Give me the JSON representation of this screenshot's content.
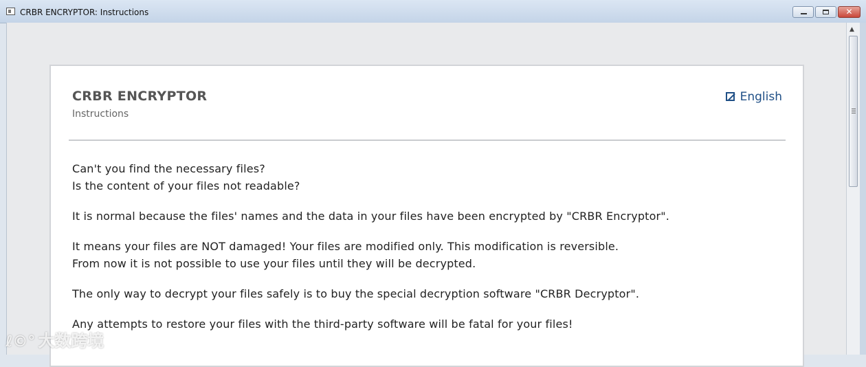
{
  "window": {
    "title": "CRBR ENCRYPTOR: Instructions",
    "close_glyph": "✕"
  },
  "header": {
    "brand": "CRBR ENCRYPTOR",
    "subtitle": "Instructions",
    "language": "English",
    "language_icon": "external-link-icon"
  },
  "body": {
    "p1_line1": "Can't you find the necessary files?",
    "p1_line2": "Is the content of your files not readable?",
    "p2": "It is normal because the files' names and the data in your files have been encrypted by \"CRBR Encryptor\".",
    "p3_line1": "It means your files are NOT damaged! Your files are modified only. This modification is reversible.",
    "p3_line2": "From now it is not possible to use your files until they will be decrypted.",
    "p4": "The only way to decrypt your files safely is to buy the special decryption software \"CRBR Decryptor\".",
    "p5": "Any attempts to restore your files with the third-party software will be fatal for your files!"
  },
  "watermark": {
    "logo": "ℓ©°",
    "text": "大数跨境"
  }
}
